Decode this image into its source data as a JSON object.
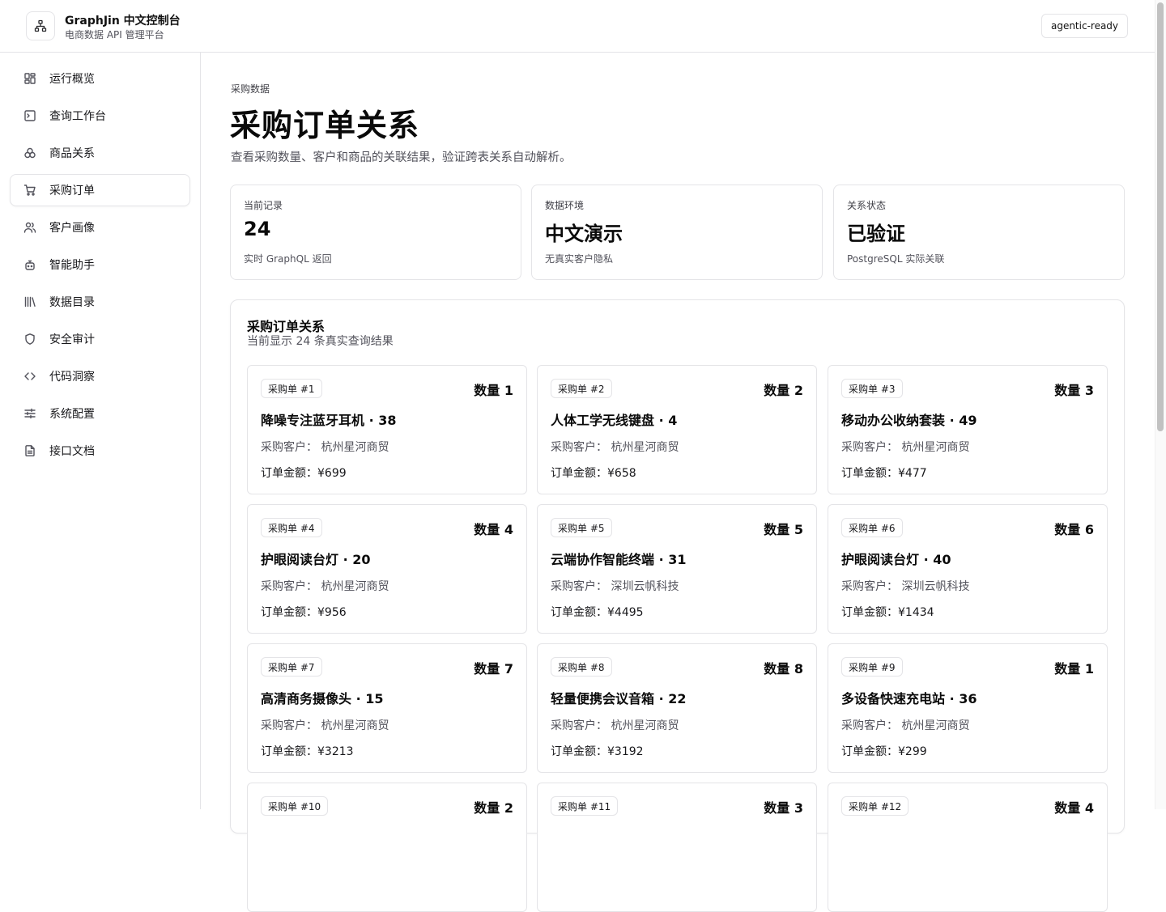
{
  "header": {
    "title": "GraphJin 中文控制台",
    "subtitle": "电商数据 API 管理平台",
    "badge": "agentic-ready",
    "logo_icon": "network-icon"
  },
  "sidebar": {
    "items": [
      {
        "label": "运行概览",
        "icon": "dashboard-icon",
        "active": false
      },
      {
        "label": "查询工作台",
        "icon": "terminal-icon",
        "active": false
      },
      {
        "label": "商品关系",
        "icon": "circles-icon",
        "active": false
      },
      {
        "label": "采购订单",
        "icon": "cart-icon",
        "active": true
      },
      {
        "label": "客户画像",
        "icon": "users-icon",
        "active": false
      },
      {
        "label": "智能助手",
        "icon": "bot-icon",
        "active": false
      },
      {
        "label": "数据目录",
        "icon": "library-icon",
        "active": false
      },
      {
        "label": "安全审计",
        "icon": "shield-icon",
        "active": false
      },
      {
        "label": "代码洞察",
        "icon": "code-icon",
        "active": false
      },
      {
        "label": "系统配置",
        "icon": "sliders-icon",
        "active": false
      },
      {
        "label": "接口文档",
        "icon": "file-icon",
        "active": false
      }
    ]
  },
  "main": {
    "kicker": "采购数据",
    "title": "采购订单关系",
    "description": "查看采购数量、客户和商品的关联结果，验证跨表关系自动解析。",
    "stats": [
      {
        "label": "当前记录",
        "value": "24",
        "note": "实时 GraphQL 返回"
      },
      {
        "label": "数据环境",
        "value": "中文演示",
        "note": "无真实客户隐私"
      },
      {
        "label": "关系状态",
        "value": "已验证",
        "note": "PostgreSQL 实际关联"
      }
    ],
    "panel": {
      "title": "采购订单关系",
      "subtitle": "当前显示 24 条真实查询结果"
    },
    "orders": [
      {
        "tag": "采购单 #1",
        "qty": "数量 1",
        "product": "降噪专注蓝牙耳机 · 38",
        "customer": "采购客户：  杭州星河商贸",
        "amount": "订单金额：¥699"
      },
      {
        "tag": "采购单 #2",
        "qty": "数量 2",
        "product": "人体工学无线键盘 · 4",
        "customer": "采购客户：  杭州星河商贸",
        "amount": "订单金额：¥658"
      },
      {
        "tag": "采购单 #3",
        "qty": "数量 3",
        "product": "移动办公收纳套装 · 49",
        "customer": "采购客户：  杭州星河商贸",
        "amount": "订单金额：¥477"
      },
      {
        "tag": "采购单 #4",
        "qty": "数量 4",
        "product": "护眼阅读台灯 · 20",
        "customer": "采购客户：  杭州星河商贸",
        "amount": "订单金额：¥956"
      },
      {
        "tag": "采购单 #5",
        "qty": "数量 5",
        "product": "云端协作智能终端 · 31",
        "customer": "采购客户：  深圳云帆科技",
        "amount": "订单金额：¥4495"
      },
      {
        "tag": "采购单 #6",
        "qty": "数量 6",
        "product": "护眼阅读台灯 · 40",
        "customer": "采购客户：  深圳云帆科技",
        "amount": "订单金额：¥1434"
      },
      {
        "tag": "采购单 #7",
        "qty": "数量 7",
        "product": "高清商务摄像头 · 15",
        "customer": "采购客户：  杭州星河商贸",
        "amount": "订单金额：¥3213"
      },
      {
        "tag": "采购单 #8",
        "qty": "数量 8",
        "product": "轻量便携会议音箱 · 22",
        "customer": "采购客户：  杭州星河商贸",
        "amount": "订单金额：¥3192"
      },
      {
        "tag": "采购单 #9",
        "qty": "数量 1",
        "product": "多设备快速充电站 · 36",
        "customer": "采购客户：  杭州星河商贸",
        "amount": "订单金额：¥299"
      },
      {
        "tag": "采购单 #10",
        "qty": "数量 2",
        "product": "",
        "customer": "",
        "amount": ""
      },
      {
        "tag": "采购单 #11",
        "qty": "数量 3",
        "product": "",
        "customer": "",
        "amount": ""
      },
      {
        "tag": "采购单 #12",
        "qty": "数量 4",
        "product": "",
        "customer": "",
        "amount": ""
      }
    ]
  }
}
